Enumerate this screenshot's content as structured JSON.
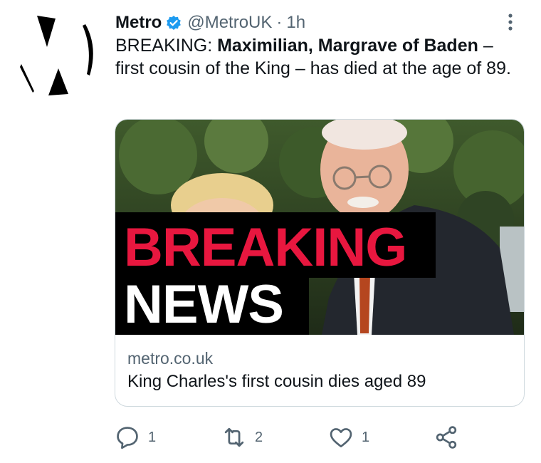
{
  "tweet": {
    "display_name": "Metro",
    "handle": "@MetroUK",
    "separator": "·",
    "time": "1h",
    "text_prefix": "BREAKING: ",
    "text_bold": "Maximilian, Margrave of Baden",
    "text_suffix": " – first cousin of the King – has died at the age of 89."
  },
  "card": {
    "banner_line1": "BREAKING",
    "banner_line2": "NEWS",
    "domain": "metro.co.uk",
    "title": "King Charles's first cousin dies aged 89"
  },
  "actions": {
    "reply_count": "1",
    "retweet_count": "2",
    "like_count": "1"
  },
  "colors": {
    "verified": "#1d9bf0",
    "breaking_red": "#e8173f",
    "muted_text": "#536471"
  },
  "icons": {
    "avatar": "metro-logo-icon",
    "verified": "verified-badge-icon",
    "more": "more-dots-icon",
    "reply": "reply-icon",
    "retweet": "retweet-icon",
    "like": "heart-icon",
    "share": "share-icon"
  }
}
